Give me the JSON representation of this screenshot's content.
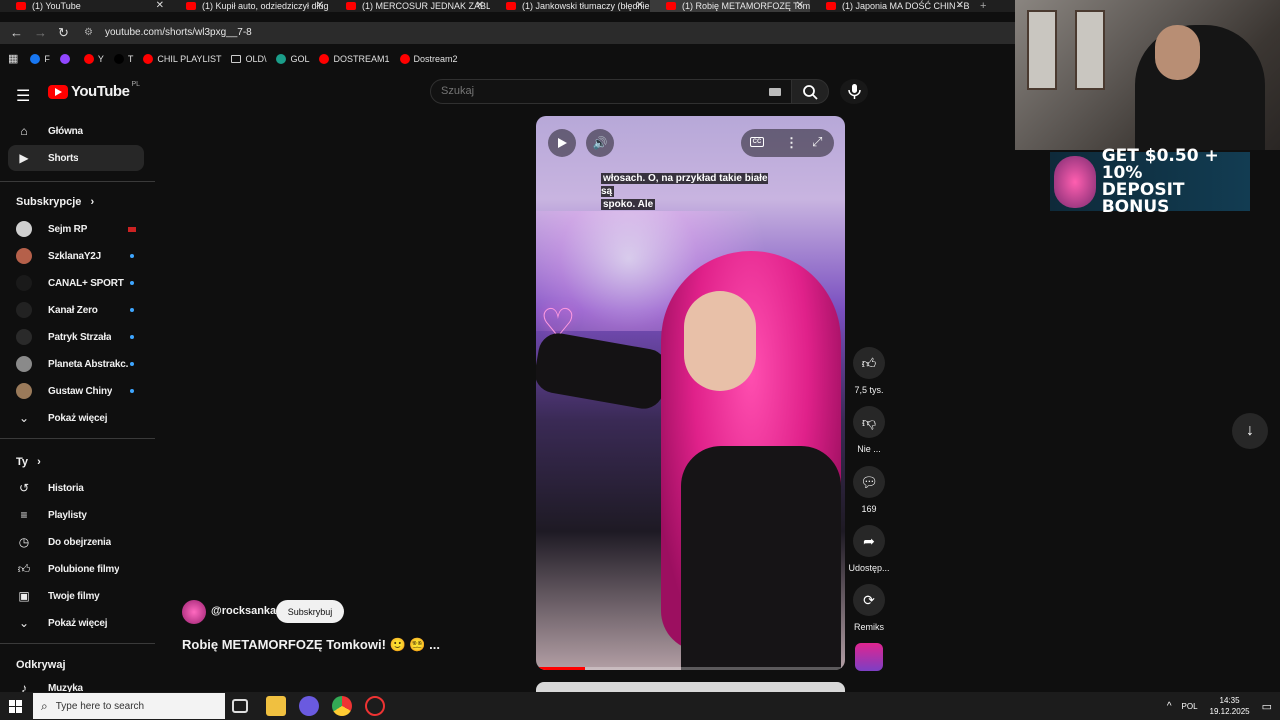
{
  "browser": {
    "tabs": [
      {
        "label": "(1) YouTube",
        "active": false
      },
      {
        "label": "(1) Kupił auto, odziedziczył dług",
        "active": false
      },
      {
        "label": "(1) MERCOSUR JEDNAK ZABLO",
        "active": false
      },
      {
        "label": "(1) Jankowski tłumaczy (błędnie",
        "active": false
      },
      {
        "label": "(1) Robię METAMORFOZĘ Tomk",
        "active": true
      },
      {
        "label": "(1) Japonia MA DOŚĆ CHIN - B",
        "active": false
      }
    ],
    "url": "youtube.com/shorts/wl3pxg__7-8",
    "bookmarks": [
      {
        "label": "F",
        "color": "#1877f2"
      },
      {
        "label": "",
        "color": "#9146ff"
      },
      {
        "label": "Y",
        "color": "#ff0000"
      },
      {
        "label": "T",
        "color": "#000000"
      },
      {
        "label": "CHIL PLAYLIST",
        "color": "#ff0000"
      },
      {
        "label": "OLD\\",
        "color": "folder"
      },
      {
        "label": "GOL",
        "color": "#1b9e8a"
      },
      {
        "label": "DOSTREAM1",
        "color": "#ff0000"
      },
      {
        "label": "Dostream2",
        "color": "#ff0000"
      }
    ]
  },
  "youtube": {
    "logo": "YouTube",
    "region": "PL",
    "search_placeholder": "Szukaj"
  },
  "sidebar": {
    "main": [
      {
        "label": "Główna",
        "icon": "home-icon"
      },
      {
        "label": "Shorts",
        "icon": "shorts-icon",
        "selected": true
      }
    ],
    "subscriptions_title": "Subskrypcje",
    "subscriptions": [
      {
        "label": "Sejm RP",
        "avatar": "#cfcfcf",
        "status": "live"
      },
      {
        "label": "SzklanaY2J",
        "avatar": "#b5604a",
        "status": "dot"
      },
      {
        "label": "CANAL+ SPORT",
        "avatar": "#1a1a1a",
        "status": "dot"
      },
      {
        "label": "Kanał Zero",
        "avatar": "#222222",
        "status": "dot"
      },
      {
        "label": "Patryk Strzała",
        "avatar": "#2a2a2a",
        "status": "dot"
      },
      {
        "label": "Planeta Abstrakc...",
        "avatar": "#8a8a8a",
        "status": "dot"
      },
      {
        "label": "Gustaw Chiny",
        "avatar": "#9a7a5a",
        "status": "dot"
      }
    ],
    "show_more": "Pokaż więcej",
    "you_title": "Ty",
    "you": [
      {
        "label": "Historia",
        "icon": "history-icon"
      },
      {
        "label": "Playlisty",
        "icon": "playlist-icon"
      },
      {
        "label": "Do obejrzenia",
        "icon": "watch-later-icon"
      },
      {
        "label": "Polubione filmy",
        "icon": "liked-icon"
      },
      {
        "label": "Twoje filmy",
        "icon": "your-videos-icon"
      }
    ],
    "show_more_2": "Pokaż więcej",
    "explore_title": "Odkrywaj",
    "explore": [
      {
        "label": "Muzyka",
        "icon": "music-icon"
      }
    ]
  },
  "video": {
    "caption_line1": "włosach. O, na przykład takie białe są",
    "caption_line2": "spoko. Ale",
    "progress": 0.16,
    "channel": "@rocksanka",
    "subscribe": "Subskrybuj",
    "title": "Robię METAMORFOZĘ Tomkowi! 🙂 😵‍💫 ..."
  },
  "actions": {
    "likes": "7,5 tys.",
    "dislike": "Nie ...",
    "comments": "169",
    "share": "Udostęp...",
    "remix": "Remiks"
  },
  "ad": {
    "line1": "GET $0.50 + 10%",
    "line2": "DEPOSIT BONUS"
  },
  "taskbar": {
    "search_placeholder": "Type here to search",
    "language": "POL",
    "time": "14:35",
    "date": "19.12.2025"
  }
}
